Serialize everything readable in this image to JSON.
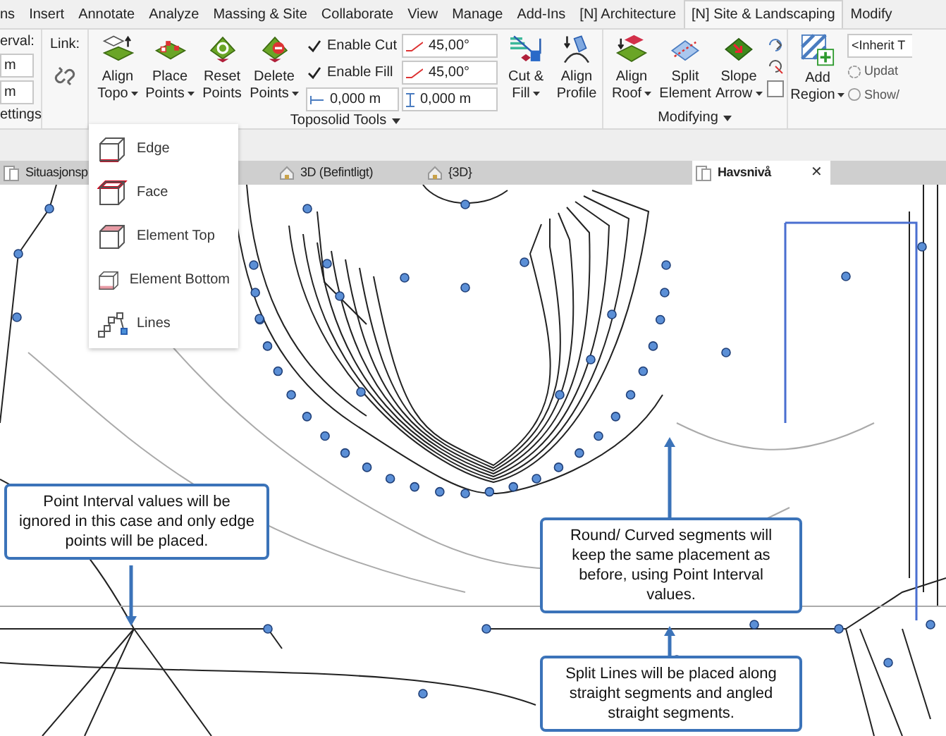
{
  "ribbon_tabs": [
    {
      "label": "ns",
      "selected": false
    },
    {
      "label": "Insert",
      "selected": false
    },
    {
      "label": "Annotate",
      "selected": false
    },
    {
      "label": "Analyze",
      "selected": false
    },
    {
      "label": "Massing & Site",
      "selected": false
    },
    {
      "label": "Collaborate",
      "selected": false
    },
    {
      "label": "View",
      "selected": false
    },
    {
      "label": "Manage",
      "selected": false
    },
    {
      "label": "Add-Ins",
      "selected": false
    },
    {
      "label": "[N] Architecture",
      "selected": false
    },
    {
      "label": "[N] Site & Landscaping",
      "selected": true
    },
    {
      "label": "Modify",
      "selected": false
    }
  ],
  "settings_panel": {
    "label": "erval:",
    "fields": [
      "m",
      "m"
    ],
    "title": "ettings"
  },
  "link": {
    "label": "Link:"
  },
  "toposolid_panel": {
    "title": "Toposolid Tools",
    "buttons": [
      {
        "kind": "align-topo",
        "lines": [
          "Align",
          "Topo"
        ],
        "dropdown": true
      },
      {
        "kind": "place-points",
        "lines": [
          "Place",
          "Points"
        ],
        "dropdown": true
      },
      {
        "kind": "reset-points",
        "lines": [
          "Reset",
          "Points"
        ],
        "dropdown": false
      },
      {
        "kind": "delete-points",
        "lines": [
          "Delete",
          "Points"
        ],
        "dropdown": true
      }
    ],
    "checks": [
      {
        "label": "Enable Cut",
        "checked": true
      },
      {
        "label": "Enable Fill",
        "checked": true
      }
    ],
    "angles": [
      "45,00°",
      "45,00°"
    ],
    "offsets": [
      "0,000 m",
      "0,000 m"
    ],
    "extra_buttons": [
      {
        "kind": "cut-fill",
        "lines": [
          "Cut &",
          "Fill"
        ],
        "dropdown": true
      },
      {
        "kind": "align-profile",
        "lines": [
          "Align",
          "Profile"
        ],
        "dropdown": false
      }
    ]
  },
  "modifying_panel": {
    "title": "Modifying",
    "buttons": [
      {
        "kind": "align-roof",
        "lines": [
          "Align",
          "Roof"
        ],
        "dropdown": true
      },
      {
        "kind": "split",
        "lines": [
          "Split",
          "Element"
        ],
        "dropdown": false
      },
      {
        "kind": "slope",
        "lines": [
          "Slope",
          "Arrow"
        ],
        "dropdown": true
      }
    ],
    "toggle": {
      "checked": false
    }
  },
  "region_panel": {
    "button": {
      "lines": [
        "Add",
        "Region"
      ],
      "dropdown": true
    },
    "type_field": "<Inherit T",
    "options": [
      "Updat",
      "Show/"
    ]
  },
  "menu": [
    {
      "kind": "edge",
      "label": "Edge"
    },
    {
      "kind": "face",
      "label": "Face"
    },
    {
      "kind": "top",
      "label": "Element Top"
    },
    {
      "kind": "bottom",
      "label": "Element Bottom"
    },
    {
      "kind": "lines",
      "label": "Lines"
    }
  ],
  "view_tabs": [
    {
      "kind": "plan",
      "label": "Situasjonsp",
      "selected": false,
      "closable": false
    },
    {
      "kind": "model",
      "label": "3D (Befintligt)",
      "selected": false,
      "closable": false
    },
    {
      "kind": "model",
      "label": "{3D}",
      "selected": false,
      "closable": false
    },
    {
      "kind": "plan",
      "label": "Havsnivå",
      "selected": true,
      "closable": true
    }
  ],
  "close_symbol": "✕",
  "callouts": [
    "Point Interval values will be ignored in this case and only edge points will be placed.",
    "Round/ Curved segments will keep the same placement as before, using Point Interval values.",
    "Split Lines will be placed along straight segments and angled straight segments."
  ]
}
